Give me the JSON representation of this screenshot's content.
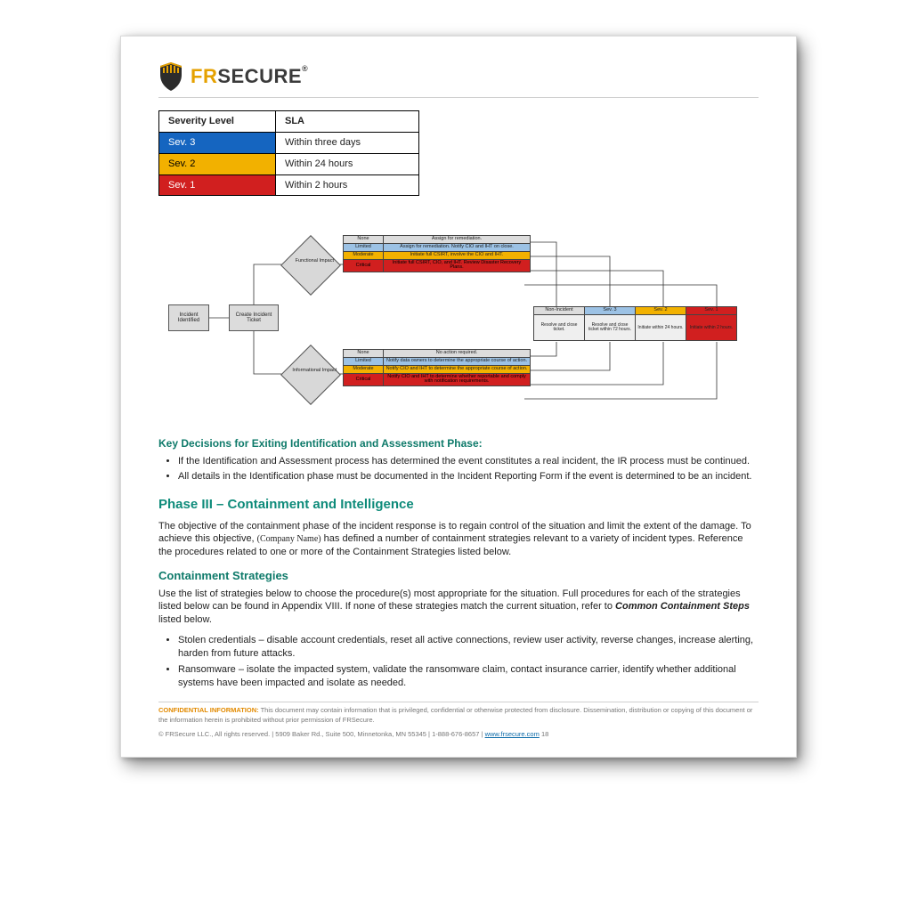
{
  "logo": {
    "part1": "FR",
    "part2": "SECURE",
    "reg": "®"
  },
  "sev_table": {
    "headers": [
      "Severity Level",
      "SLA"
    ],
    "rows": [
      {
        "label": "Sev. 3",
        "sla": "Within three days",
        "color": "blue"
      },
      {
        "label": "Sev. 2",
        "sla": "Within 24 hours",
        "color": "yellow"
      },
      {
        "label": "Sev. 1",
        "sla": "Within 2 hours",
        "color": "red"
      }
    ]
  },
  "flow": {
    "incident_identified": "Incident Identified",
    "create_ticket": "Create Incident Ticket",
    "decision_functional": "Functional Impact",
    "decision_informational": "Informational Impact",
    "functional_matrix": [
      {
        "level": "None",
        "desc": "Assign for remediation."
      },
      {
        "level": "Limited",
        "desc": "Assign for remediation. Notify CIO and IHT on close."
      },
      {
        "level": "Moderate",
        "desc": "Initiate full CSIRT, involve the CIO and IHT."
      },
      {
        "level": "Critical",
        "desc": "Initiate full CSIRT, CIO, and IHT. Review Disaster Recovery Plans."
      }
    ],
    "informational_matrix": [
      {
        "level": "None",
        "desc": "No action required."
      },
      {
        "level": "Limited",
        "desc": "Notify data owners to determine the appropriate course of action."
      },
      {
        "level": "Moderate",
        "desc": "Notify CIO and IHT to determine the appropriate course of action."
      },
      {
        "level": "Critical",
        "desc": "Notify CIO and IHT to determine whether reportable and comply with notification requirements."
      }
    ],
    "severity_strip": {
      "headers": [
        "Non-Incident",
        "Sev. 3",
        "Sev. 2",
        "Sev. 1"
      ],
      "cells": [
        "Resolve and close ticket.",
        "Resolve and close ticket within 72 hours.",
        "Initiate within 24 hours.",
        "Initiate within 2 hours."
      ]
    }
  },
  "sections": {
    "key_decisions_title": "Key Decisions for Exiting Identification and Assessment Phase:",
    "key_decisions_bullets": [
      "If the Identification and Assessment process has determined the event constitutes a real incident, the IR process must be continued.",
      "All details in the Identification phase must be documented in the Incident Reporting Form if the event is determined to be an incident."
    ],
    "phase3_title": "Phase III – Containment and Intelligence",
    "phase3_body_a": "The objective of the containment phase of the incident response is to regain control of the situation and limit the extent of the damage.  To achieve this objective, ",
    "phase3_company": "(Company Name)",
    "phase3_body_b": " has defined a number of containment strategies relevant to a variety of incident types. Reference the procedures related to one or more of the Containment Strategies listed below.",
    "containment_title": "Containment Strategies",
    "containment_intro_a": "Use the list of strategies below to choose the procedure(s) most appropriate for the situation. Full procedures for each of the strategies listed below can be found in Appendix VIII. If none of these strategies match the current situation, refer to ",
    "containment_intro_bold": "Common Containment Steps",
    "containment_intro_b": " listed below.",
    "containment_bullets": [
      "Stolen credentials – disable account credentials, reset all active connections, review user activity, reverse changes, increase alerting, harden from future attacks.",
      "Ransomware – isolate the impacted system, validate the ransomware claim, contact insurance carrier, identify whether additional systems have been impacted and isolate as needed."
    ]
  },
  "footer": {
    "conf_label": "CONFIDENTIAL INFORMATION:",
    "conf_text": " This document may contain information that is privileged, confidential or otherwise protected from disclosure. Dissemination, distribution or copying of this document or the information herein is prohibited without prior permission of FRSecure.",
    "copyright": "© FRSecure LLC., All rights reserved. | 5909 Baker Rd., Suite 500, Minnetonka, MN 55345 | 1-888-676-8657 | ",
    "link_text": "www.frsecure.com",
    "page_no": "   18"
  }
}
